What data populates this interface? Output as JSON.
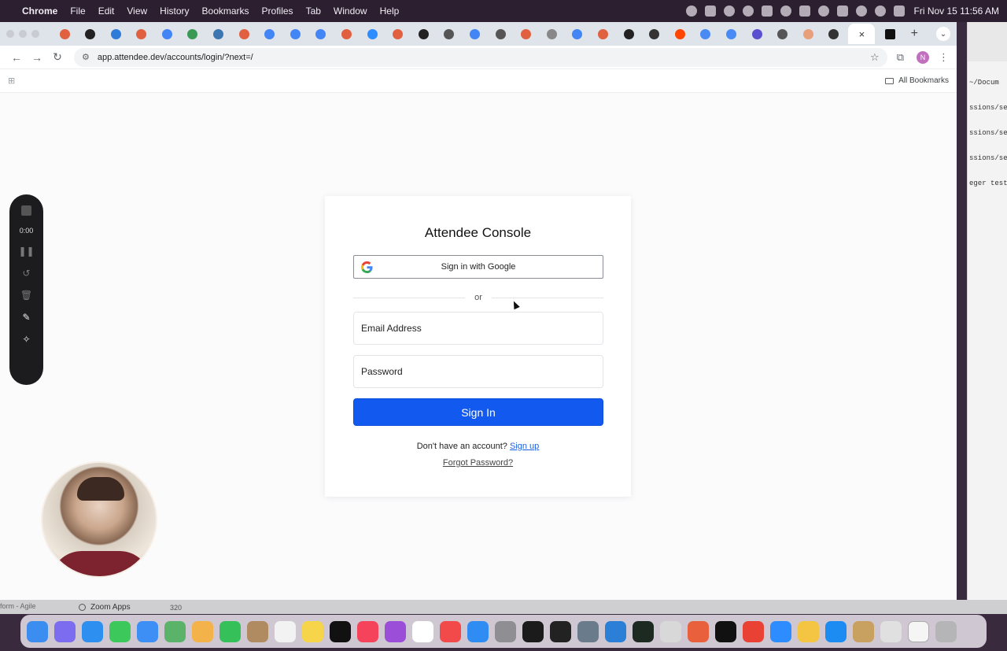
{
  "menubar": {
    "app": "Chrome",
    "items": [
      "File",
      "Edit",
      "View",
      "History",
      "Bookmarks",
      "Profiles",
      "Tab",
      "Window",
      "Help"
    ],
    "clock": "Fri Nov 15  11:56 AM"
  },
  "browser": {
    "url": "app.attendee.dev/accounts/login/?next=/",
    "active_tab_close": "×",
    "new_tab": "+",
    "avatar_initial": "N",
    "bookmarks_label": "All Bookmarks"
  },
  "login": {
    "title": "Attendee Console",
    "google_button": "Sign in with Google",
    "divider": "or",
    "email_placeholder": "Email Address",
    "password_placeholder": "Password",
    "signin_button": "Sign In",
    "no_account": "Don't have an account? ",
    "signup_link": "Sign up",
    "forgot_link": "Forgot Password?"
  },
  "recorder": {
    "time": "0:00"
  },
  "background_window": {
    "lines": [
      "~/Docum",
      "ssions/se",
      "ssions/se",
      "ssions/se",
      "eger test"
    ],
    "zoom_apps": "Zoom Apps",
    "count": "320",
    "left_fragment": "form - Agile"
  },
  "colors": {
    "primary": "#1259f0",
    "link": "#1a5fdc",
    "menubar": "#2b1f30"
  }
}
